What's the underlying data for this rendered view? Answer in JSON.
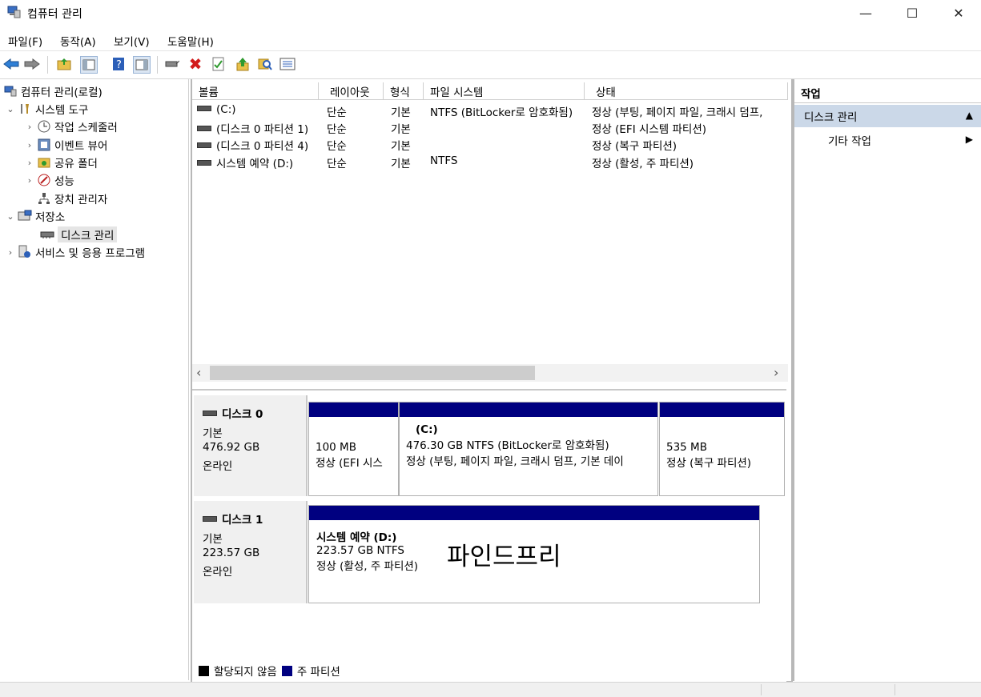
{
  "window": {
    "title": "컴퓨터 관리",
    "minimize": "—",
    "maximize": "☐",
    "close": "✕"
  },
  "menu": [
    "파일(F)",
    "동작(A)",
    "보기(V)",
    "도움말(H)"
  ],
  "tree": {
    "root": "컴퓨터 관리(로컬)",
    "system_tools": "시스템 도구",
    "task_scheduler": "작업 스케줄러",
    "event_viewer": "이벤트 뷰어",
    "shared_folders": "공유 폴더",
    "performance": "성능",
    "device_manager": "장치 관리자",
    "storage": "저장소",
    "disk_management": "디스크 관리",
    "services_apps": "서비스 및 응용 프로그램"
  },
  "volumes": {
    "headers": [
      "볼륨",
      "레이아웃",
      "형식",
      "파일 시스템",
      "상태"
    ],
    "rows": [
      [
        "(C:)",
        "단순",
        "기본",
        "NTFS (BitLocker로 암호화됨)",
        "정상 (부팅, 페이지 파일, 크래시 덤프,"
      ],
      [
        "(디스크 0 파티션 1)",
        "단순",
        "기본",
        "",
        "정상 (EFI 시스템 파티션)"
      ],
      [
        "(디스크 0 파티션 4)",
        "단순",
        "기본",
        "",
        "정상 (복구 파티션)"
      ],
      [
        "시스템 예약 (D:)",
        "단순",
        "기본",
        "NTFS",
        "정상 (활성, 주 파티션)"
      ]
    ]
  },
  "scroll": {
    "left": "‹",
    "right": "›"
  },
  "disks": [
    {
      "name": "디스크 0",
      "type": "기본",
      "size": "476.92 GB",
      "status": "온라인",
      "partitions": [
        {
          "title": "",
          "size": "100 MB",
          "status": "정상 (EFI 시스"
        },
        {
          "title": "(C:)",
          "size": "476.30 GB NTFS (BitLocker로 암호화됨)",
          "status": "정상 (부팅, 페이지 파일, 크래시 덤프, 기본 데이"
        },
        {
          "title": "",
          "size": "535 MB",
          "status": "정상 (복구 파티션)"
        }
      ]
    },
    {
      "name": "디스크 1",
      "type": "기본",
      "size": "223.57 GB",
      "status": "온라인",
      "partitions": [
        {
          "title": "시스템 예약  (D:)",
          "size": "223.57 GB NTFS",
          "status": "정상 (활성, 주 파티션)"
        }
      ]
    }
  ],
  "overlay_text": "파인드프리",
  "legend": {
    "unallocated": "할당되지 않음",
    "primary": "주 파티션"
  },
  "actions": {
    "header": "작업",
    "section": "디스크 관리",
    "more": "기타 작업",
    "collapse_glyph": "▲",
    "expand_glyph": "▶"
  },
  "colors": {
    "primary_partition": "#000080",
    "unallocated": "#000000",
    "selected_section": "#cbd8e8"
  }
}
